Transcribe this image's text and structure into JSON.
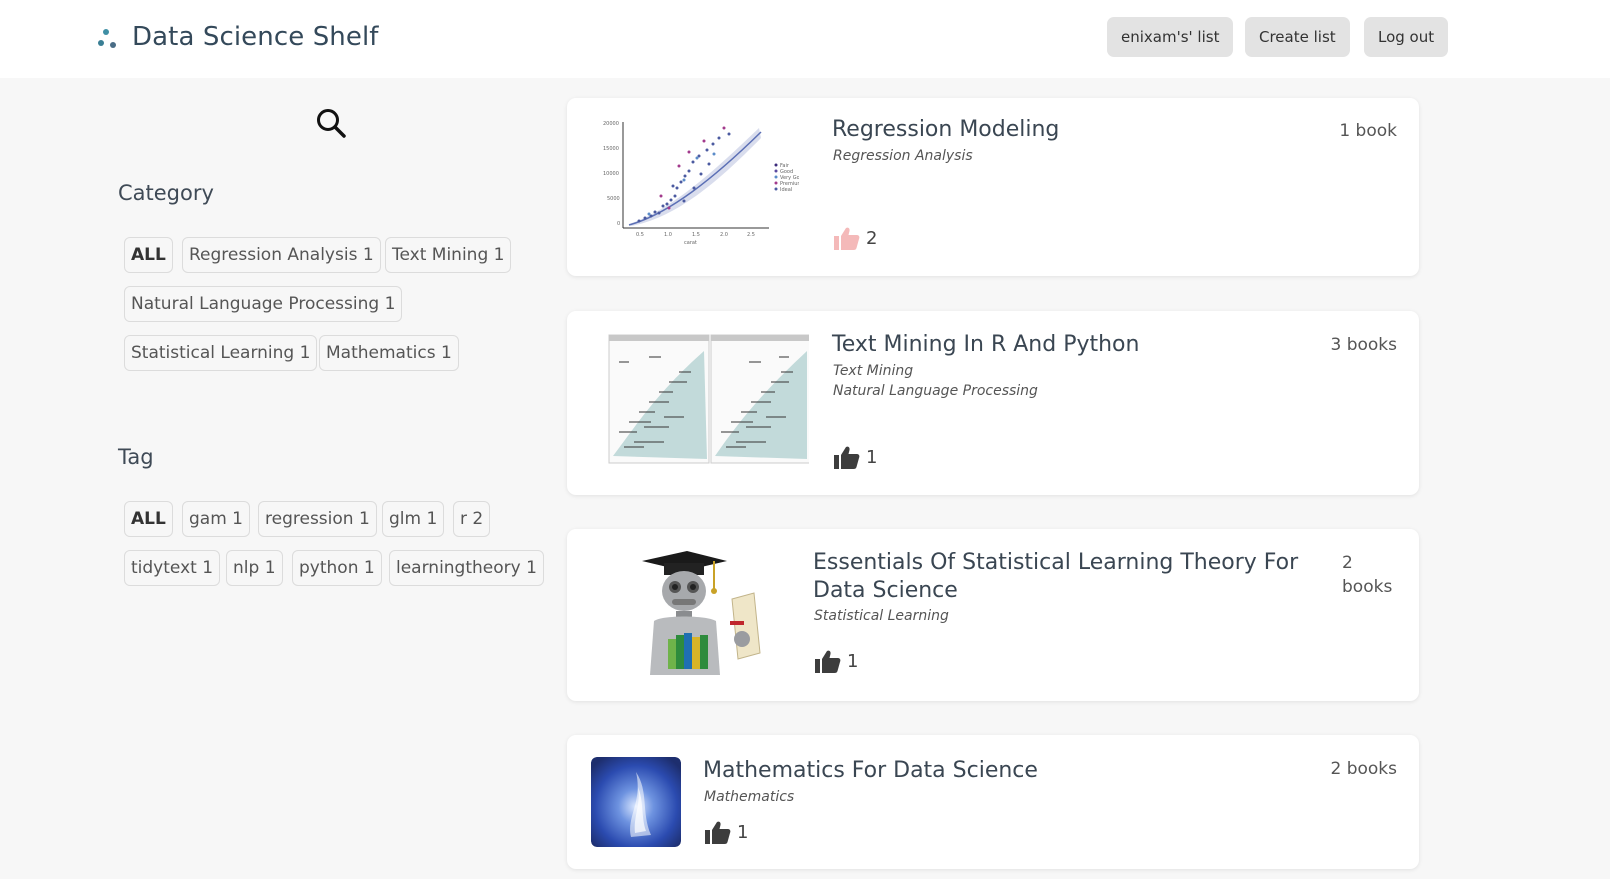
{
  "header": {
    "app_title": "Data Science Shelf",
    "user_list_label": "enixam's' list",
    "create_list_label": "Create list",
    "logout_label": "Log out"
  },
  "sidebar": {
    "category_title": "Category",
    "categories": [
      {
        "label": "ALL"
      },
      {
        "label": "Regression Analysis 1"
      },
      {
        "label": "Text Mining 1"
      },
      {
        "label": "Natural Language Processing 1"
      },
      {
        "label": "Statistical Learning 1"
      },
      {
        "label": "Mathematics 1"
      }
    ],
    "tag_title": "Tag",
    "tags": [
      {
        "label": "ALL"
      },
      {
        "label": "gam 1"
      },
      {
        "label": "regression 1"
      },
      {
        "label": "glm 1"
      },
      {
        "label": "r 2"
      },
      {
        "label": "tidytext 1"
      },
      {
        "label": "nlp 1"
      },
      {
        "label": "python 1"
      },
      {
        "label": "learningtheory 1"
      }
    ]
  },
  "lists": [
    {
      "title": "Regression Modeling",
      "categories": [
        "Regression Analysis"
      ],
      "count": "1 book",
      "likes": "2",
      "liked": true
    },
    {
      "title": "Text Mining In R And Python",
      "categories": [
        "Text Mining",
        "Natural Language Processing"
      ],
      "count": "3 books",
      "likes": "1",
      "liked": false
    },
    {
      "title": "Essentials Of Statistical Learning Theory For Data Science",
      "categories": [
        "Statistical Learning"
      ],
      "count": "2 books",
      "likes": "1",
      "liked": false
    },
    {
      "title": "Mathematics For Data Science",
      "categories": [
        "Mathematics"
      ],
      "count": "2 books",
      "likes": "1",
      "liked": false
    }
  ],
  "colors": {
    "accent": "#3f8fa5",
    "like_active": "#f4b9b9",
    "like_default": "#3d3d3d"
  }
}
